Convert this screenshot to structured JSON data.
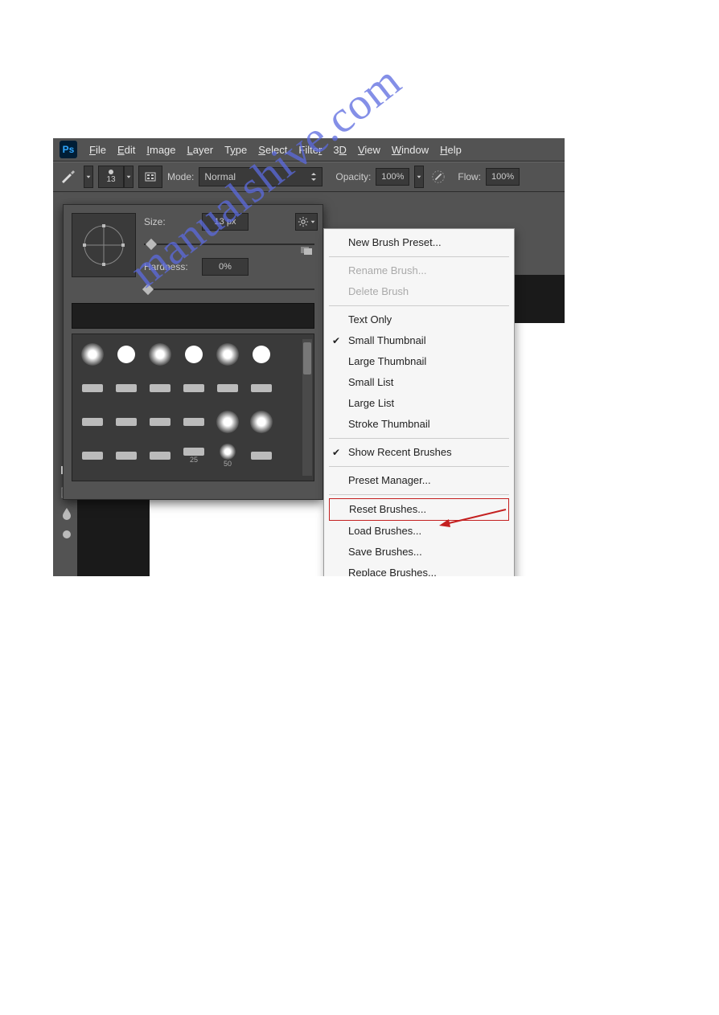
{
  "watermark": "manualshive.com",
  "menubar": {
    "items": [
      "File",
      "Edit",
      "Image",
      "Layer",
      "Type",
      "Select",
      "Filter",
      "3D",
      "View",
      "Window",
      "Help"
    ]
  },
  "options": {
    "brush_size": "13",
    "mode_label": "Mode:",
    "mode_value": "Normal",
    "opacity_label": "Opacity:",
    "opacity_value": "100%",
    "flow_label": "Flow:",
    "flow_value": "100%"
  },
  "brush_panel": {
    "size_label": "Size:",
    "size_value": "13 px",
    "hardness_label": "Hardness:",
    "hardness_value": "0%",
    "grid_labels": {
      "b25": "25",
      "b50": "50"
    }
  },
  "context_menu": {
    "new_preset": "New Brush Preset...",
    "rename": "Rename Brush...",
    "delete": "Delete Brush",
    "text_only": "Text Only",
    "small_thumb": "Small Thumbnail",
    "large_thumb": "Large Thumbnail",
    "small_list": "Small List",
    "large_list": "Large List",
    "stroke_thumb": "Stroke Thumbnail",
    "show_recent": "Show Recent Brushes",
    "preset_mgr": "Preset Manager...",
    "reset": "Reset Brushes...",
    "load": "Load Brushes...",
    "save": "Save Brushes...",
    "replace": "Replace Brushes..."
  }
}
